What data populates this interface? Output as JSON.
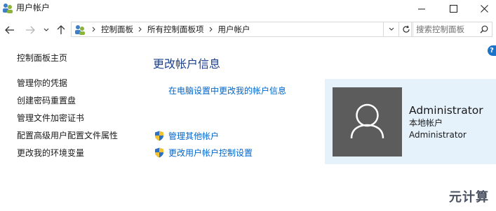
{
  "window": {
    "title": "用户帐户",
    "icon": "users-control-panel-icon",
    "controls": [
      "minimize-icon",
      "maximize-icon",
      "close-icon"
    ]
  },
  "navbar": {
    "breadcrumbs": [
      "控制面板",
      "所有控制面板项",
      "用户帐户"
    ],
    "search_placeholder": "搜索控制面板"
  },
  "sidebar": {
    "items": [
      {
        "label": "控制面板主页"
      },
      {
        "label": "管理你的凭据"
      },
      {
        "label": "创建密码重置盘"
      },
      {
        "label": "管理文件加密证书"
      },
      {
        "label": "配置高级用户配置文件属性"
      },
      {
        "label": "更改我的环境变量"
      }
    ]
  },
  "main": {
    "title": "更改帐户信息",
    "pc_settings_link": "在电脑设置中更改我的帐户信息",
    "actions": [
      {
        "label": "管理其他帐户",
        "icon": "uac-shield-icon"
      },
      {
        "label": "更改用户帐户控制设置",
        "icon": "uac-shield-icon"
      }
    ]
  },
  "user": {
    "name": "Administrator",
    "account_type": "本地帐户",
    "group": "Administrator"
  },
  "help_label": "?",
  "watermark": "元计算",
  "colors": {
    "link": "#0066cc",
    "heading": "#1a3f8f",
    "user_panel_bg": "#e5f1fb",
    "avatar_bg": "#5c5c5c"
  }
}
